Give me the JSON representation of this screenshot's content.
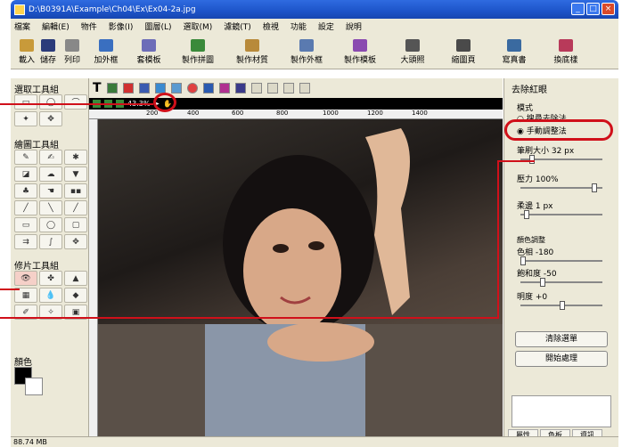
{
  "window": {
    "title": "D:\\B0391A\\Example\\Ch04\\Ex\\Ex04-2a.jpg"
  },
  "menu": [
    "檔案",
    "編輯(E)",
    "物件",
    "影像(I)",
    "圖層(L)",
    "選取(M)",
    "濾鏡(T)",
    "檢視",
    "功能",
    "設定",
    "說明"
  ],
  "toolbar": [
    {
      "label": "載入",
      "icon": "open-folder-icon"
    },
    {
      "label": "儲存",
      "icon": "save-icon"
    },
    {
      "label": "列印",
      "icon": "print-icon"
    },
    {
      "label": "加外框",
      "icon": "frame-icon"
    },
    {
      "label": "套模板",
      "icon": "template-icon"
    },
    {
      "label": "製作拼圖",
      "icon": "puzzle-icon"
    },
    {
      "label": "製作材質",
      "icon": "texture-icon"
    },
    {
      "label": "製作外框",
      "icon": "make-frame-icon"
    },
    {
      "label": "製作模板",
      "icon": "make-template-icon"
    },
    {
      "label": "大頭照",
      "icon": "portrait-icon"
    },
    {
      "label": "縮圖頁",
      "icon": "thumbnail-icon"
    },
    {
      "label": "寫真書",
      "icon": "photobook-icon"
    },
    {
      "label": "換底樣",
      "icon": "background-swap-icon"
    }
  ],
  "left": {
    "select_group": "選取工具組",
    "paint_group": "繪圖工具組",
    "retouch_group": "修片工具組",
    "color_label": "顏色"
  },
  "doc": {
    "zoom": "43.3%"
  },
  "ruler": [
    "200",
    "400",
    "600",
    "800",
    "1000",
    "1200",
    "1400"
  ],
  "right": {
    "title": "去除紅眼",
    "mode_label": "模式",
    "mode_auto": "搜尋去除法",
    "mode_manual": "手動調整法",
    "brush": "筆刷大小 32 px",
    "pressure": "壓力 100%",
    "feather": "柔邊 1 px",
    "color_adjust": "顏色調整",
    "hue": "色相 -180",
    "saturation": "飽和度 -50",
    "brightness": "明度 +0",
    "clear_btn": "清除選單",
    "start_btn": "開始處理",
    "tabs": [
      "屬性",
      "色板",
      "資訊"
    ]
  },
  "status": {
    "memory": "88.74 MB"
  }
}
